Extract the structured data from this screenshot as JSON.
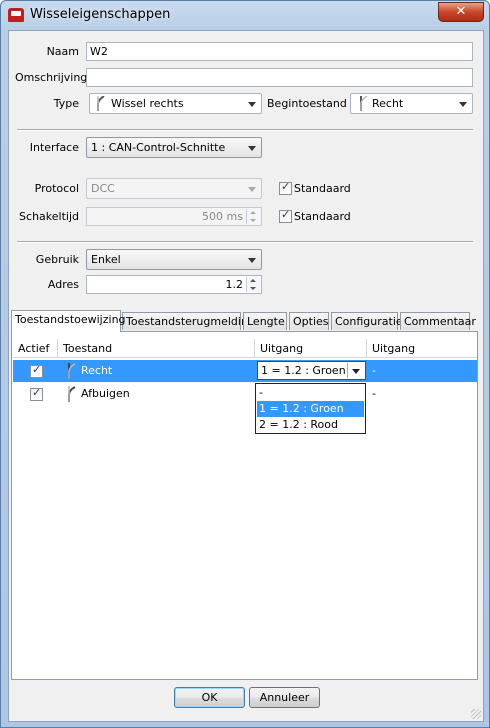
{
  "window": {
    "title": "Wisseleigenschappen",
    "close_glyph": "✕"
  },
  "form": {
    "naam": {
      "label": "Naam",
      "value": "W2"
    },
    "omschrijving": {
      "label": "Omschrijving",
      "value": ""
    },
    "type": {
      "label": "Type",
      "value": "Wissel rechts",
      "icon": "switch-right-icon"
    },
    "begintoestand": {
      "label": "Begintoestand",
      "value": "Recht",
      "icon": "switch-straight-icon"
    },
    "interface": {
      "label": "Interface",
      "value": "1 : CAN-Control-Schnitte"
    },
    "protocol": {
      "label": "Protocol",
      "value": "DCC",
      "standaard_label": "Standaard",
      "standaard_checked": true
    },
    "schakeltijd": {
      "label": "Schakeltijd",
      "value": "500 ms",
      "standaard_label": "Standaard",
      "standaard_checked": true
    },
    "gebruik": {
      "label": "Gebruik",
      "value": "Enkel"
    },
    "adres": {
      "label": "Adres",
      "value": "1.2"
    }
  },
  "tabs": [
    {
      "label": "Toestandstoewijzing",
      "active": true
    },
    {
      "label": "Toestandsterugmelding",
      "active": false
    },
    {
      "label": "Lengte",
      "active": false
    },
    {
      "label": "Opties",
      "active": false
    },
    {
      "label": "Configuratie",
      "active": false
    },
    {
      "label": "Commentaar",
      "active": false
    }
  ],
  "table": {
    "headers": [
      "Actief",
      "Toestand",
      "Uitgang",
      "Uitgang"
    ],
    "rows": [
      {
        "actief": true,
        "toestand": "Recht",
        "uitgang1": "1 = 1.2 : Groen",
        "uitgang2": "-",
        "selected": true
      },
      {
        "actief": true,
        "toestand": "Afbuigen",
        "uitgang1": "",
        "uitgang2": "-",
        "selected": false
      }
    ],
    "dropdown_options": [
      "-",
      "1 = 1.2 : Groen",
      "2 = 1.2 : Rood"
    ],
    "dropdown_selected_index": 1
  },
  "buttons": {
    "ok": "OK",
    "cancel": "Annuleer"
  },
  "colors": {
    "selection": "#3399ff",
    "title_bar": "#b9cee6",
    "close_button": "#c7462a"
  }
}
